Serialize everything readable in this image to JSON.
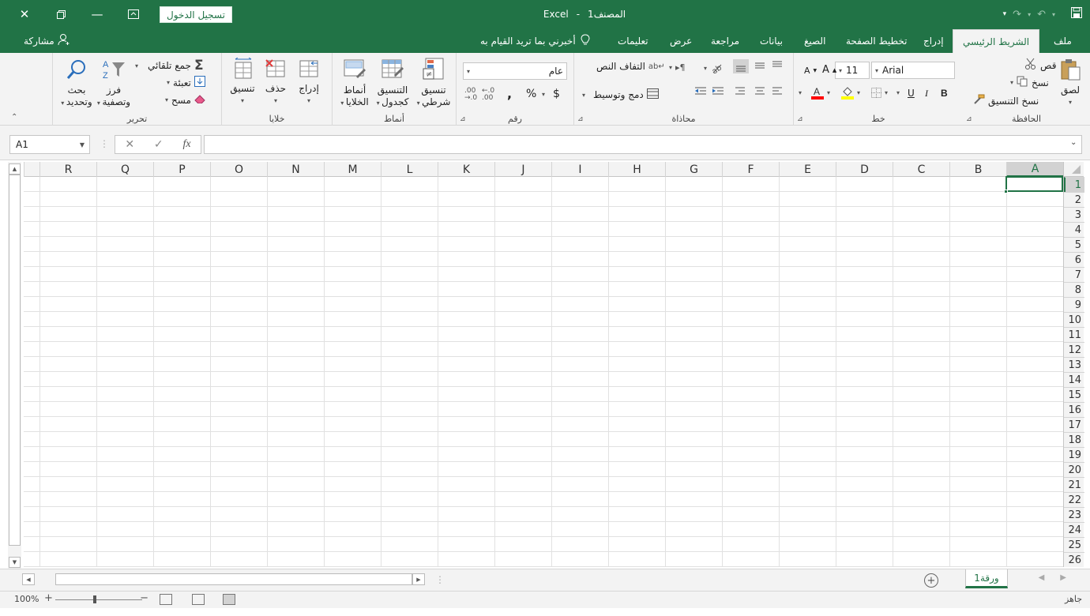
{
  "title_bar": {
    "app_title": "المصنف1 - Excel",
    "book_name": "المصنف1",
    "app_name": "Excel",
    "sign_in_label": "تسجيل الدخول",
    "icons": [
      "close-icon",
      "restore-icon",
      "minimize-icon",
      "ribbon-display-icon",
      "save-icon",
      "undo-icon",
      "redo-icon",
      "customize-qat-icon"
    ]
  },
  "tabs": {
    "file": "ملف",
    "home": "الشريط الرئيسي",
    "insert": "إدراج",
    "page_layout": "تخطيط الصفحة",
    "formulas": "الصيغ",
    "data": "بيانات",
    "review": "مراجعة",
    "view": "عرض",
    "help": "تعليمات",
    "tell_me": "أخبرني بما تريد القيام به",
    "share": "مشاركة"
  },
  "ribbon": {
    "clipboard": {
      "label": "الحافظة",
      "paste": "لصق",
      "cut": "قص",
      "copy": "نسخ",
      "format_painter": "نسخ التنسيق"
    },
    "font": {
      "label": "خط",
      "font_name": "Arial",
      "font_size": "11",
      "bold": "B",
      "italic": "I",
      "underline": "U"
    },
    "alignment": {
      "label": "محاذاة",
      "wrap_text": "التفاف النص",
      "merge_center": "دمج وتوسيط"
    },
    "number": {
      "label": "رقم",
      "format": "عام",
      "currency": "$",
      "percent": "%",
      "comma": ","
    },
    "styles": {
      "label": "أنماط",
      "conditional_1": "تنسيق",
      "conditional_2": "شرطي",
      "format_table_1": "التنسيق",
      "format_table_2": "كجدول",
      "cell_styles_1": "أنماط",
      "cell_styles_2": "الخلايا"
    },
    "cells": {
      "label": "خلايا",
      "insert": "إدراج",
      "delete": "حذف",
      "format": "تنسيق"
    },
    "editing": {
      "label": "تحرير",
      "autosum": "جمع تلقائي",
      "fill": "تعبئة",
      "clear": "مسح",
      "sort_1": "فرز",
      "sort_2": "وتصفية",
      "find_1": "بحث",
      "find_2": "وتحديد"
    }
  },
  "formula_bar": {
    "name_box": "A1",
    "fx": "fx",
    "formula_value": ""
  },
  "columns": [
    "A",
    "B",
    "C",
    "D",
    "E",
    "F",
    "G",
    "H",
    "I",
    "J",
    "K",
    "L",
    "M",
    "N",
    "O",
    "P",
    "Q",
    "R"
  ],
  "rows": [
    "1",
    "2",
    "3",
    "4",
    "5",
    "6",
    "7",
    "8",
    "9",
    "10",
    "11",
    "12",
    "13",
    "14",
    "15",
    "16",
    "17",
    "18",
    "19",
    "20",
    "21",
    "22",
    "23",
    "24",
    "25",
    "26"
  ],
  "active_cell": "A1",
  "sheets": {
    "active_sheet": "ورقة1"
  },
  "status_bar": {
    "status": "جاهز",
    "zoom": "100%"
  },
  "colors": {
    "brand": "#217346",
    "ribbon_bg": "#f3f3f3",
    "font_color_red": "#ff0000",
    "highlight_yellow": "#ffff00"
  }
}
